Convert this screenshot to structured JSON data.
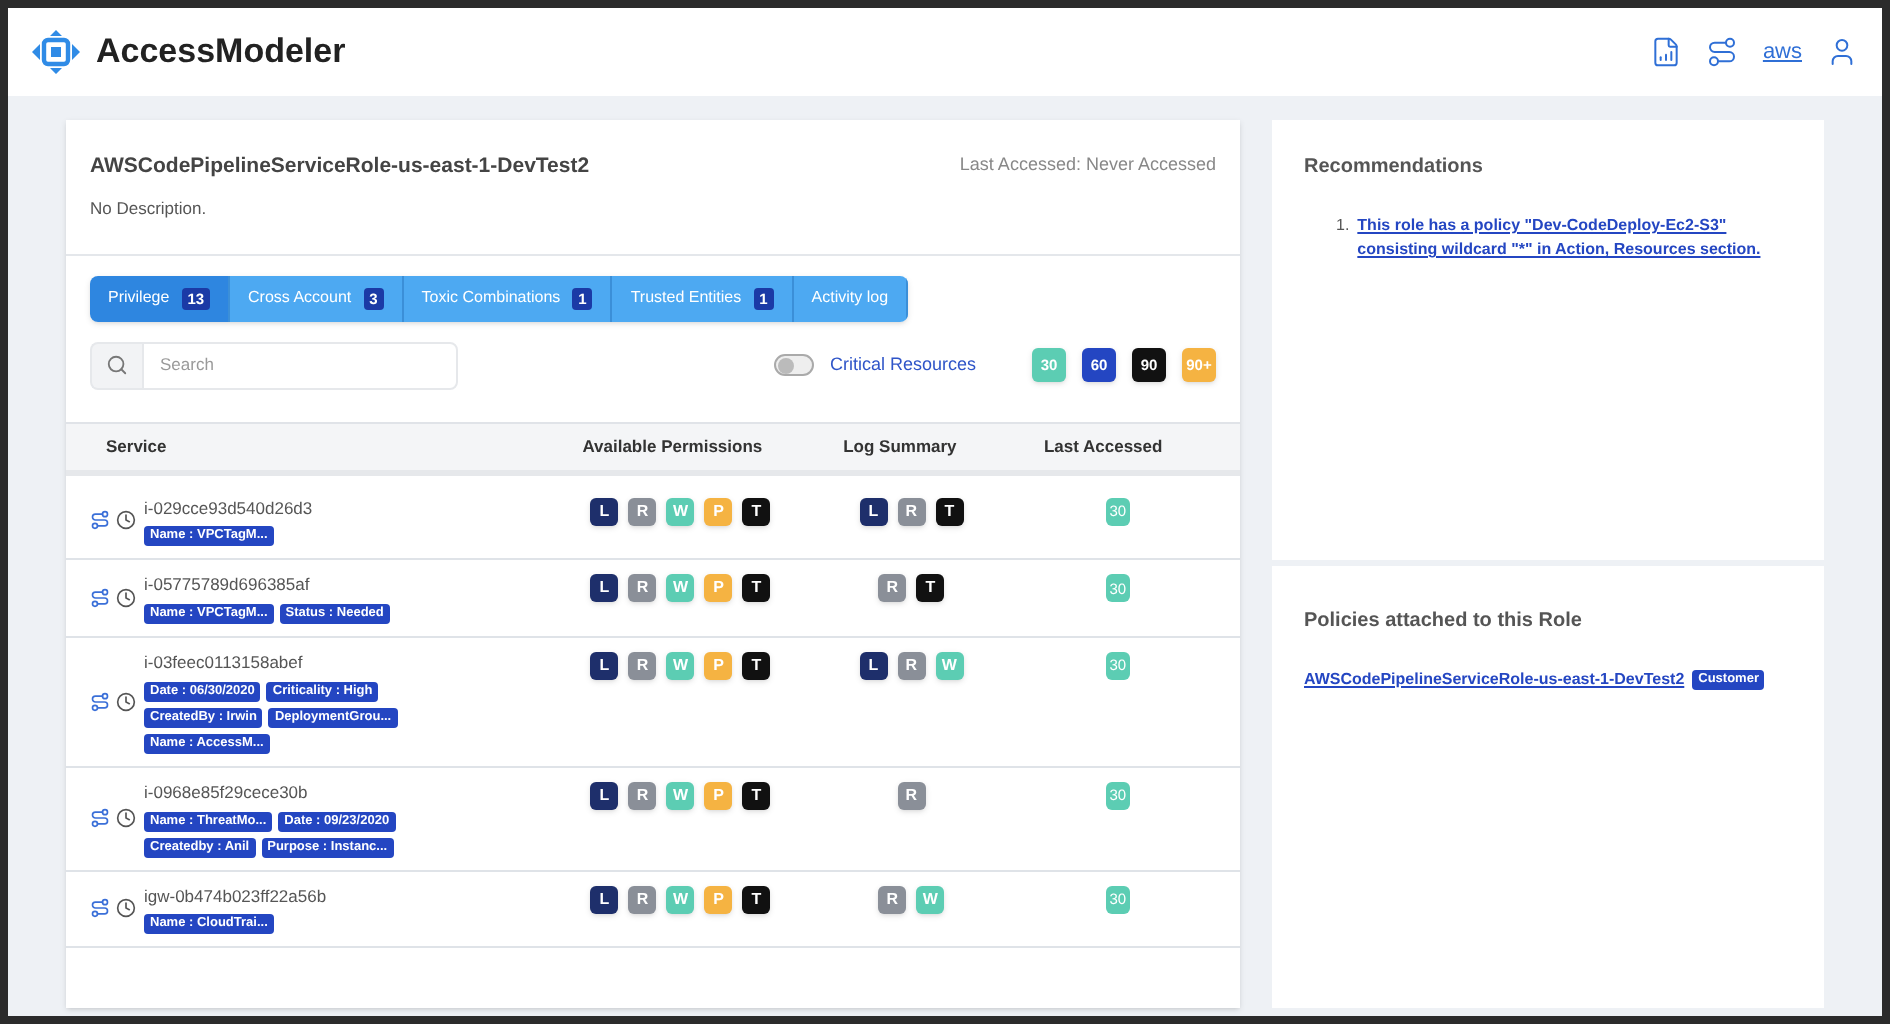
{
  "app": {
    "name": "AccessModeler",
    "aws_label": "aws"
  },
  "role": {
    "name": "AWSCodePipelineServiceRole-us-east-1-DevTest2",
    "description": "No Description.",
    "last_accessed": "Last Accessed: Never Accessed"
  },
  "tabs": [
    {
      "label": "Privilege",
      "count": "13",
      "selected": true
    },
    {
      "label": "Cross Account",
      "count": "3",
      "selected": false
    },
    {
      "label": "Toxic Combinations",
      "count": "1",
      "selected": false
    },
    {
      "label": "Trusted Entities",
      "count": "1",
      "selected": false
    },
    {
      "label": "Activity log",
      "selected": false
    }
  ],
  "search": {
    "placeholder": "Search"
  },
  "critical_toggle": {
    "label": "Critical Resources",
    "on": false
  },
  "legend": [
    {
      "label": "30",
      "color": "#5ccdb3"
    },
    {
      "label": "60",
      "color": "#2446c2"
    },
    {
      "label": "90",
      "color": "#111111"
    },
    {
      "label": "90+",
      "color": "#f5b342"
    }
  ],
  "table": {
    "columns": [
      "Service",
      "Available Permissions",
      "Log Summary",
      "Last Accessed"
    ],
    "rows": [
      {
        "id": "i-029cce93d540d26d3",
        "tag_lines": [
          [
            "Name : VPCTagM..."
          ]
        ],
        "permissions": [
          {
            "label": "L",
            "color": "#1e2f6b"
          },
          {
            "label": "R",
            "color": "#8a8f98"
          },
          {
            "label": "W",
            "color": "#5ccdb3"
          },
          {
            "label": "P",
            "color": "#f5b342"
          },
          {
            "label": "T",
            "color": "#111111"
          }
        ],
        "log": [
          {
            "label": "L",
            "color": "#1e2f6b"
          },
          {
            "label": "R",
            "color": "#8a8f98"
          },
          {
            "label": "T",
            "color": "#111111"
          }
        ],
        "last": {
          "label": "30",
          "color": "#5ccdb3"
        }
      },
      {
        "id": "i-05775789d696385af",
        "tag_lines": [
          [
            "Name : VPCTagM...",
            "Status : Needed"
          ]
        ],
        "permissions": [
          {
            "label": "L",
            "color": "#1e2f6b"
          },
          {
            "label": "R",
            "color": "#8a8f98"
          },
          {
            "label": "W",
            "color": "#5ccdb3"
          },
          {
            "label": "P",
            "color": "#f5b342"
          },
          {
            "label": "T",
            "color": "#111111"
          }
        ],
        "log": [
          {
            "label": "R",
            "color": "#8a8f98"
          },
          {
            "label": "T",
            "color": "#111111"
          }
        ],
        "last": {
          "label": "30",
          "color": "#5ccdb3"
        }
      },
      {
        "id": "i-03feec0113158abef",
        "tag_lines": [
          [
            "Date : 06/30/2020",
            "Criticality : High"
          ],
          [
            "CreatedBy : Irwin",
            "DeploymentGrou..."
          ],
          [
            "Name : AccessM..."
          ]
        ],
        "permissions": [
          {
            "label": "L",
            "color": "#1e2f6b"
          },
          {
            "label": "R",
            "color": "#8a8f98"
          },
          {
            "label": "W",
            "color": "#5ccdb3"
          },
          {
            "label": "P",
            "color": "#f5b342"
          },
          {
            "label": "T",
            "color": "#111111"
          }
        ],
        "log": [
          {
            "label": "L",
            "color": "#1e2f6b"
          },
          {
            "label": "R",
            "color": "#8a8f98"
          },
          {
            "label": "W",
            "color": "#5ccdb3"
          }
        ],
        "last": {
          "label": "30",
          "color": "#5ccdb3"
        }
      },
      {
        "id": "i-0968e85f29cece30b",
        "tag_lines": [
          [
            "Name : ThreatMo...",
            "Date : 09/23/2020"
          ],
          [
            "Createdby : Anil",
            "Purpose : Instanc..."
          ]
        ],
        "permissions": [
          {
            "label": "L",
            "color": "#1e2f6b"
          },
          {
            "label": "R",
            "color": "#8a8f98"
          },
          {
            "label": "W",
            "color": "#5ccdb3"
          },
          {
            "label": "P",
            "color": "#f5b342"
          },
          {
            "label": "T",
            "color": "#111111"
          }
        ],
        "log": [
          {
            "label": "R",
            "color": "#8a8f98"
          }
        ],
        "last": {
          "label": "30",
          "color": "#5ccdb3"
        }
      },
      {
        "id": "igw-0b474b023ff22a56b",
        "tag_lines": [
          [
            "Name : CloudTrai..."
          ]
        ],
        "permissions": [
          {
            "label": "L",
            "color": "#1e2f6b"
          },
          {
            "label": "R",
            "color": "#8a8f98"
          },
          {
            "label": "W",
            "color": "#5ccdb3"
          },
          {
            "label": "P",
            "color": "#f5b342"
          },
          {
            "label": "T",
            "color": "#111111"
          }
        ],
        "log": [
          {
            "label": "R",
            "color": "#8a8f98"
          },
          {
            "label": "W",
            "color": "#5ccdb3"
          }
        ],
        "last": {
          "label": "30",
          "color": "#5ccdb3"
        }
      }
    ]
  },
  "recommendations": {
    "title": "Recommendations",
    "items": [
      {
        "number": "1.",
        "text": "This role has a policy \"Dev-CodeDeploy-Ec2-S3\" consisting wildcard \"*\" in Action, Resources section."
      }
    ]
  },
  "policies": {
    "title": "Policies attached to this Role",
    "items": [
      {
        "name": "AWSCodePipelineServiceRole-us-east-1-DevTest2",
        "type": "Customer"
      }
    ]
  }
}
